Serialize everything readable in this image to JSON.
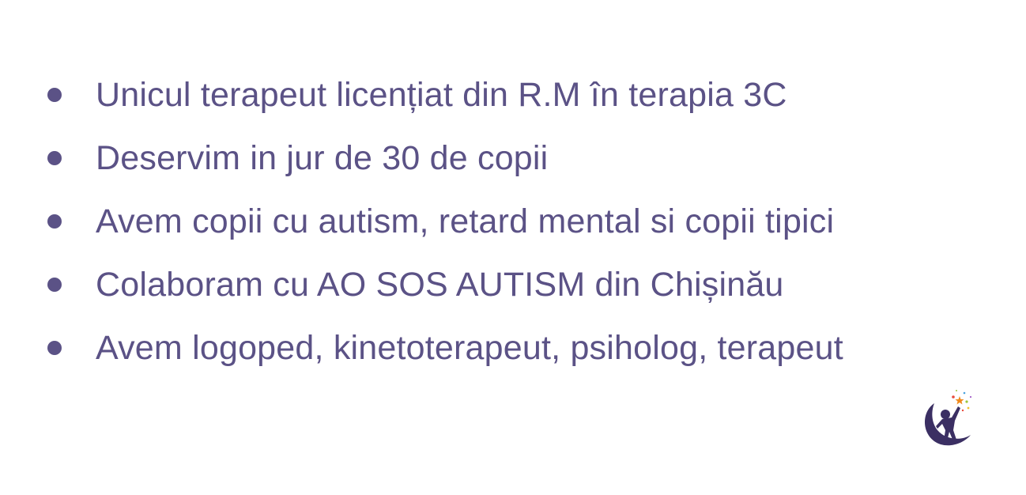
{
  "items": [
    {
      "text": "Unicul terapeut licențiat din R.M în terapia 3C"
    },
    {
      "text": "Deservim in jur de 30 de copii"
    },
    {
      "text": "Avem copii cu autism, retard mental si copii tipici"
    },
    {
      "text": "Colaboram cu AO SOS AUTISM din Chișinău"
    },
    {
      "text": "Avem logoped, kinetoterapeut, psiholog, terapeut"
    }
  ],
  "colors": {
    "text": "#5b5286",
    "bullet": "#5b5286",
    "background": "#ffffff"
  },
  "logo": {
    "icon": "child-reaching-for-stars-on-moon-logo-icon"
  }
}
